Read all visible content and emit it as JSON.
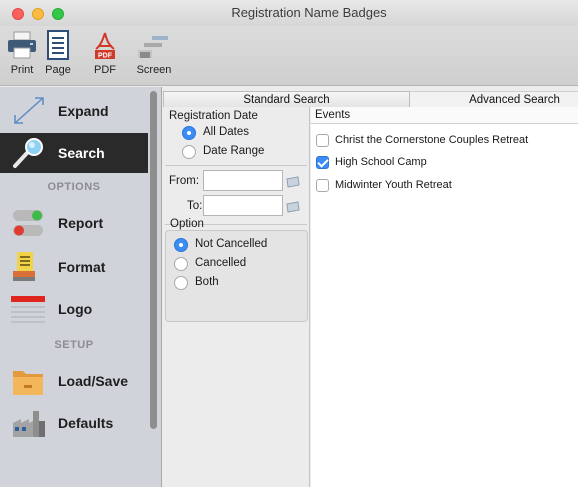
{
  "window": {
    "title": "Registration Name Badges"
  },
  "toolbar": {
    "print": {
      "label": "Print",
      "icon": "printer-icon"
    },
    "page": {
      "label": "Page",
      "icon": "page-icon"
    },
    "pdf": {
      "label": "PDF",
      "icon": "pdf-icon",
      "badge": "PDF"
    },
    "screen": {
      "label": "Screen",
      "icon": "screen-icon"
    }
  },
  "sidebar": {
    "expand": {
      "label": "Expand",
      "icon": "expand-arrows-icon"
    },
    "search": {
      "label": "Search",
      "icon": "magnifier-icon",
      "selected": true
    },
    "options_header": "OPTIONS",
    "report": {
      "label": "Report",
      "icon": "toggle-switches-icon"
    },
    "format": {
      "label": "Format",
      "icon": "format-icon"
    },
    "logo": {
      "label": "Logo",
      "icon": "logo-icon"
    },
    "setup_header": "SETUP",
    "loadsave": {
      "label": "Load/Save",
      "icon": "folder-icon"
    },
    "defaults": {
      "label": "Defaults",
      "icon": "factory-icon"
    }
  },
  "tabs": {
    "standard": "Standard Search",
    "advanced": "Advanced Search",
    "active": "standard"
  },
  "registration_date": {
    "label": "Registration Date",
    "all_dates": "All Dates",
    "date_range": "Date Range",
    "selected": "All Dates",
    "from_label": "From:",
    "from_value": "",
    "to_label": "To:",
    "to_value": ""
  },
  "option": {
    "label": "Option",
    "not_cancelled": "Not Cancelled",
    "cancelled": "Cancelled",
    "both": "Both",
    "selected": "Not Cancelled"
  },
  "events": {
    "header": "Events",
    "items": [
      {
        "name": "Christ the Cornerstone Couples Retreat",
        "checked": false
      },
      {
        "name": "High School Camp",
        "checked": true
      },
      {
        "name": "Midwinter Youth Retreat",
        "checked": false
      }
    ]
  },
  "colors": {
    "accent": "#3b8cf5",
    "sidebar_bg": "#d1d3db",
    "selected_item": "#2a2a2a"
  }
}
